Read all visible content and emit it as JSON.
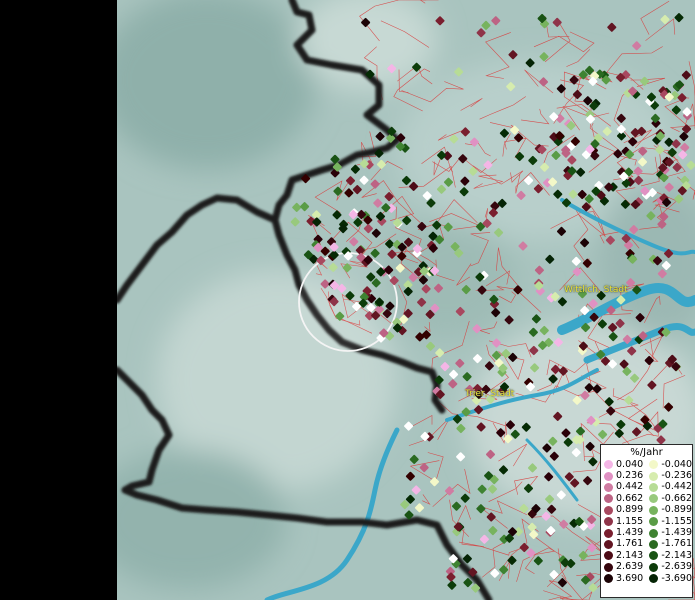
{
  "map": {
    "places": [
      {
        "name": "Wittlich, Stadt"
      },
      {
        "name": "Trier, Stadt"
      }
    ],
    "colors": {
      "water": "#3ba7c9",
      "border": "#1a1a1a",
      "admin_lines": "#d93a3a",
      "terrain": "#a9c4bf"
    }
  },
  "legend": {
    "title": "%/Jahr",
    "positive": [
      {
        "value": "0.040",
        "color": "#f4b6e6"
      },
      {
        "value": "0.236",
        "color": "#e091c3"
      },
      {
        "value": "0.442",
        "color": "#d07ca2"
      },
      {
        "value": "0.662",
        "color": "#bd6384"
      },
      {
        "value": "0.899",
        "color": "#a8485f"
      },
      {
        "value": "1.155",
        "color": "#8f3449"
      },
      {
        "value": "1.439",
        "color": "#7a1f2f"
      },
      {
        "value": "1.761",
        "color": "#621522"
      },
      {
        "value": "2.143",
        "color": "#4d0c17"
      },
      {
        "value": "2.639",
        "color": "#36060e"
      },
      {
        "value": "3.690",
        "color": "#1c0306"
      }
    ],
    "negative": [
      {
        "value": "-0.040",
        "color": "#f3f8c8"
      },
      {
        "value": "-0.236",
        "color": "#d6ecae"
      },
      {
        "value": "-0.442",
        "color": "#b7dc96"
      },
      {
        "value": "-0.662",
        "color": "#98c97d"
      },
      {
        "value": "-0.899",
        "color": "#77b35e"
      },
      {
        "value": "-1.155",
        "color": "#5a9c46"
      },
      {
        "value": "-1.439",
        "color": "#3f8332"
      },
      {
        "value": "-1.761",
        "color": "#2a6a21"
      },
      {
        "value": "-2.143",
        "color": "#195314"
      },
      {
        "value": "-2.639",
        "color": "#0d3c0a"
      },
      {
        "value": "-3.690",
        "color": "#052405"
      }
    ]
  }
}
